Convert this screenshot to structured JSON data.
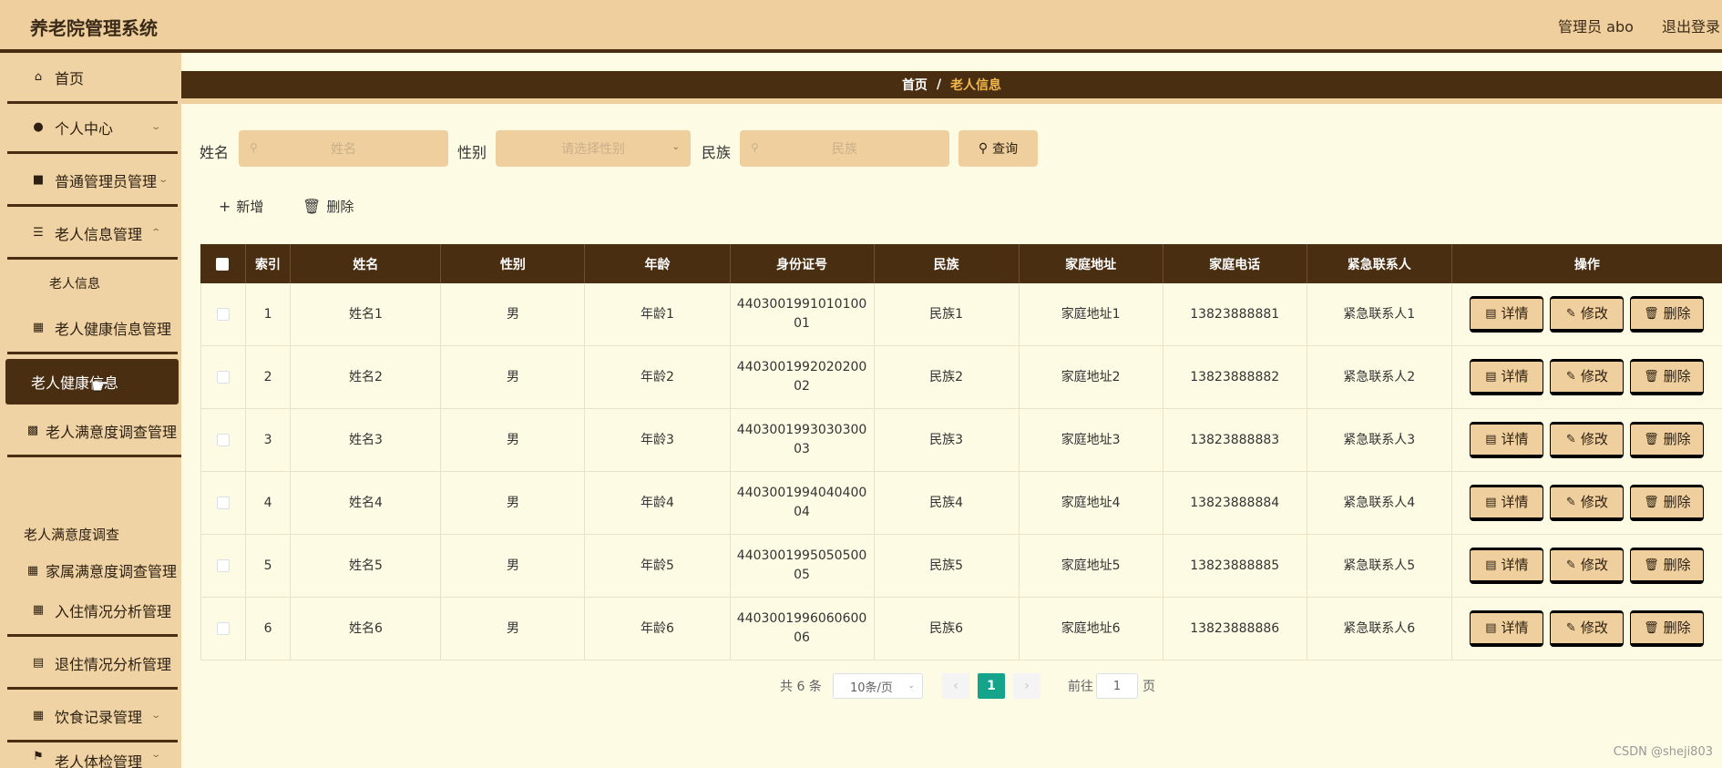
{
  "header": {
    "title": "养老院管理系统",
    "user": "管理员 abo",
    "logout": "退出登录"
  },
  "sidebar": {
    "items": [
      {
        "label": "首页"
      },
      {
        "label": "个人中心"
      },
      {
        "label": "普通管理员管理"
      },
      {
        "label": "老人信息管理"
      },
      {
        "label": "老人信息"
      },
      {
        "label": "老人健康信息管理"
      },
      {
        "label": "老人健康信息"
      },
      {
        "label": "老人满意度调查管理"
      },
      {
        "label": "老人满意度调查"
      },
      {
        "label": "家属满意度调查管理"
      },
      {
        "label": "入住情况分析管理"
      },
      {
        "label": "退住情况分析管理"
      },
      {
        "label": "饮食记录管理"
      },
      {
        "label": "老人体检管理"
      }
    ]
  },
  "breadcrumb": {
    "home": "首页",
    "separator": "/",
    "current": "老人信息"
  },
  "search": {
    "name_label": "姓名",
    "name_placeholder": "姓名",
    "gender_label": "性别",
    "gender_placeholder": "请选择性别",
    "ethnic_label": "民族",
    "ethnic_placeholder": "民族",
    "query": "查询"
  },
  "actions": {
    "add": "新增",
    "delete": "删除"
  },
  "table": {
    "headers": [
      "索引",
      "姓名",
      "性别",
      "年龄",
      "身份证号",
      "民族",
      "家庭地址",
      "家庭电话",
      "紧急联系人",
      "操作"
    ],
    "rows": [
      {
        "index": "1",
        "name": "姓名1",
        "gender": "男",
        "age": "年龄1",
        "id_line1": "4403001991010100",
        "id_line2": "01",
        "ethnic": "民族1",
        "address": "家庭地址1",
        "phone": "13823888881",
        "contact": "紧急联系人1"
      },
      {
        "index": "2",
        "name": "姓名2",
        "gender": "男",
        "age": "年龄2",
        "id_line1": "4403001992020200",
        "id_line2": "02",
        "ethnic": "民族2",
        "address": "家庭地址2",
        "phone": "13823888882",
        "contact": "紧急联系人2"
      },
      {
        "index": "3",
        "name": "姓名3",
        "gender": "男",
        "age": "年龄3",
        "id_line1": "4403001993030300",
        "id_line2": "03",
        "ethnic": "民族3",
        "address": "家庭地址3",
        "phone": "13823888883",
        "contact": "紧急联系人3"
      },
      {
        "index": "4",
        "name": "姓名4",
        "gender": "男",
        "age": "年龄4",
        "id_line1": "4403001994040400",
        "id_line2": "04",
        "ethnic": "民族4",
        "address": "家庭地址4",
        "phone": "13823888884",
        "contact": "紧急联系人4"
      },
      {
        "index": "5",
        "name": "姓名5",
        "gender": "男",
        "age": "年龄5",
        "id_line1": "4403001995050500",
        "id_line2": "05",
        "ethnic": "民族5",
        "address": "家庭地址5",
        "phone": "13823888885",
        "contact": "紧急联系人5"
      },
      {
        "index": "6",
        "name": "姓名6",
        "gender": "男",
        "age": "年龄6",
        "id_line1": "4403001996060600",
        "id_line2": "06",
        "ethnic": "民族6",
        "address": "家庭地址6",
        "phone": "13823888886",
        "contact": "紧急联系人6"
      }
    ],
    "row_actions": {
      "detail": "详情",
      "edit": "修改",
      "delete": "删除"
    }
  },
  "pagination": {
    "total": "共 6 条",
    "page_size": "10条/页",
    "current_page": "1",
    "goto_label": "前往",
    "goto_value": "1",
    "page_unit": "页"
  },
  "watermark": "CSDN @sheji803",
  "colors": {
    "header_bg": "#eecf9d",
    "dark_brown": "#4a2e12",
    "content_bg": "#fefbe4",
    "active_page": "#14a38b",
    "breadcrumb_current": "#f1b84c"
  }
}
